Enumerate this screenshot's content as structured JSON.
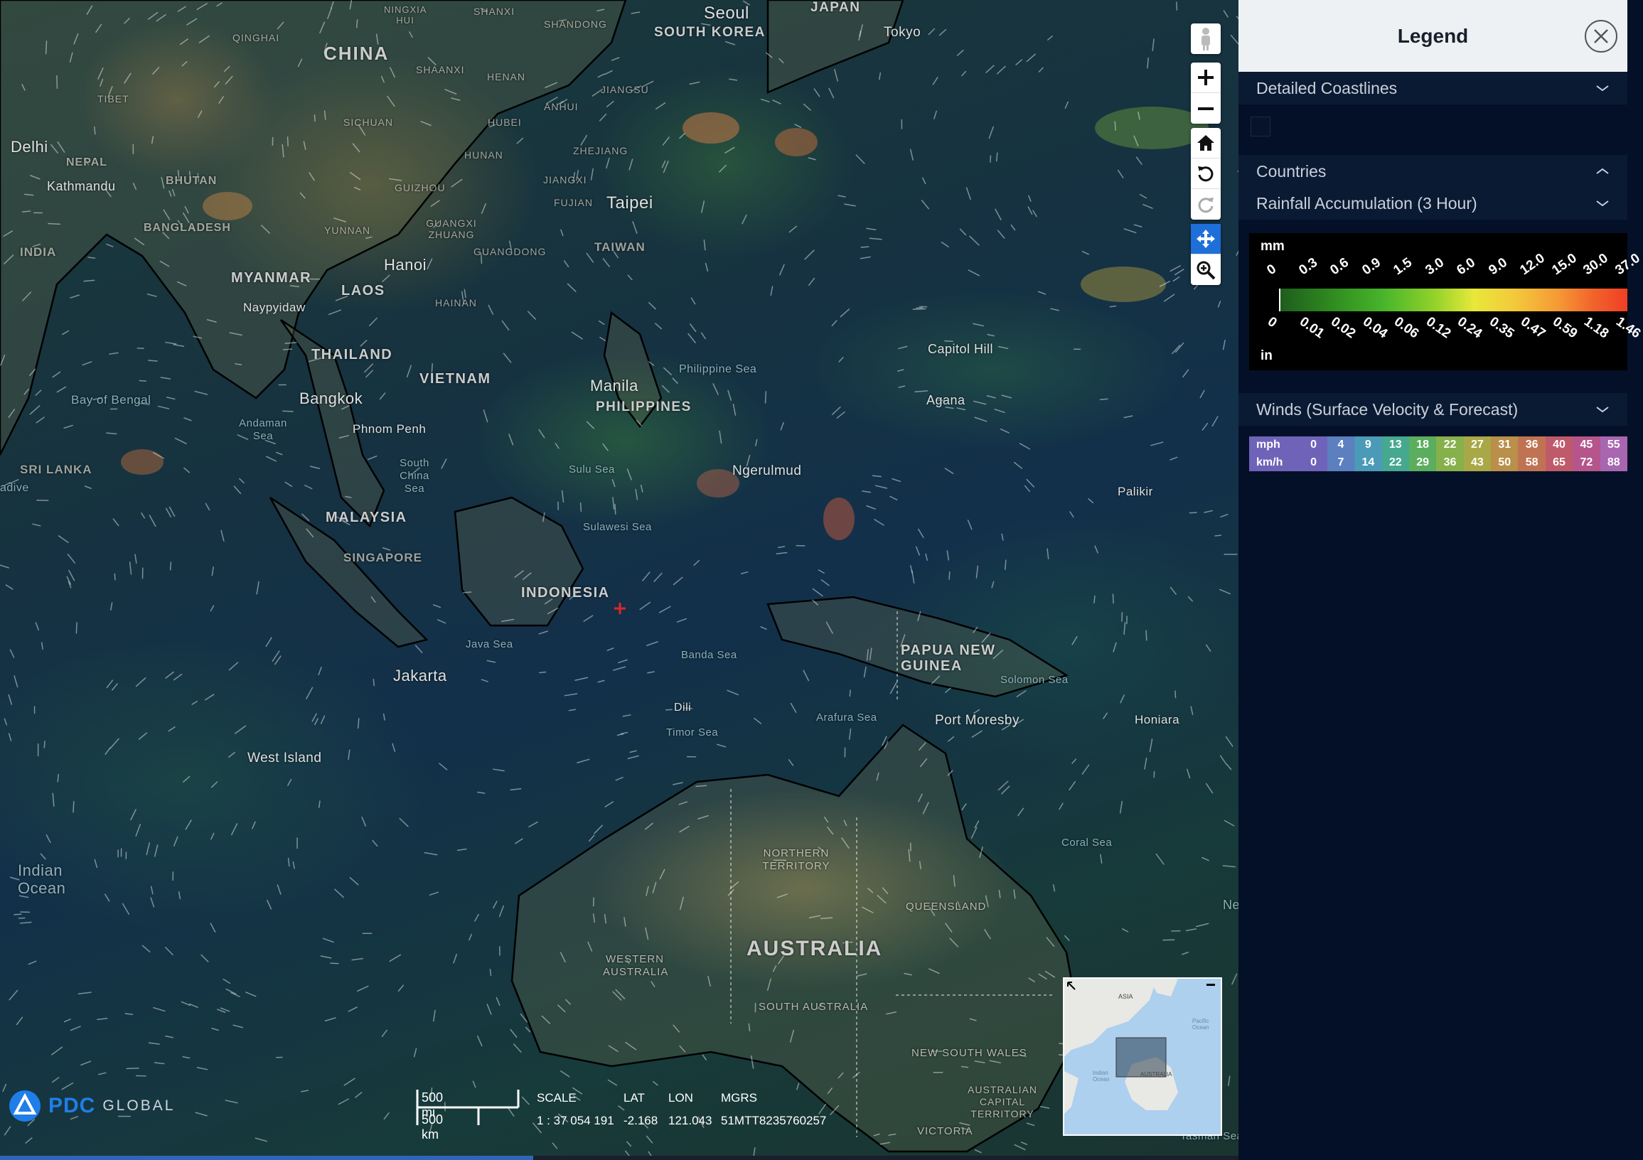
{
  "map": {
    "labels": {
      "countries": [
        "CHINA",
        "MYANMAR",
        "LAOS",
        "THAILAND",
        "VIETNAM",
        "MALAYSIA",
        "INDONESIA",
        "PAPUA NEW GUINEA",
        "AUSTRALIA",
        "INDIA",
        "BANGLADESH",
        "BHUTAN",
        "NEPAL",
        "SRI LANKA",
        "PHILIPPINES",
        "TAIWAN",
        "SINGAPORE",
        "SOUTH KOREA",
        "JAPAN"
      ],
      "regions": [
        "QINGHAI",
        "TIBET",
        "SICHUAN",
        "YUNNAN",
        "GUIZHOU",
        "HUNAN",
        "HUBEI",
        "HENAN",
        "SHAANXI",
        "ANHUI",
        "JIANGSU",
        "ZHEJIANG",
        "JIANGXI",
        "FUJIAN",
        "GUANGXI ZHUANG",
        "GUANGDONG",
        "NINGXIA HUI",
        "SHANXI",
        "SHANDONG",
        "HAINAN"
      ],
      "cities": [
        "Delhi",
        "Kathmandu",
        "Hanoi",
        "Naypyidaw",
        "Bangkok",
        "Phnom Penh",
        "Manila",
        "Taipei",
        "Seoul",
        "Tokyo",
        "Jakarta",
        "Ngerulmud",
        "Capitol Hill",
        "Agana",
        "Palikir",
        "Port Moresby",
        "Honiara",
        "West Island"
      ],
      "seas": [
        "Bay of Bengal",
        "Andaman Sea",
        "South China Sea",
        "Philippine Sea",
        "Sulu Sea",
        "Sulawesi Sea",
        "Java Sea",
        "Banda Sea",
        "Timor Sea",
        "Arafura Sea",
        "Solomon Sea",
        "Coral Sea"
      ],
      "oceans": [
        "Indian Ocean"
      ],
      "states": [
        "NORTHERN TERRITORY",
        "WESTERN AUSTRALIA",
        "QUEENSLAND",
        "SOUTH AUSTRALIA",
        "NEW SOUTH WALES",
        "AUSTRALIAN CAPITAL TERRITORY",
        "VICTORIA"
      ],
      "partial": [
        "Dili",
        "Tasman Sea",
        "adive",
        "Ne"
      ]
    },
    "toolbar": [
      {
        "name": "street-view-icon",
        "active": false
      },
      {
        "name": "zoom-in-icon",
        "active": false
      },
      {
        "name": "zoom-out-icon",
        "active": false
      },
      {
        "name": "home-icon",
        "active": false
      },
      {
        "name": "rotate-left-icon",
        "active": false
      },
      {
        "name": "rotate-right-icon",
        "active": false
      },
      {
        "name": "pan-icon",
        "active": true
      },
      {
        "name": "zoom-box-icon",
        "active": false
      }
    ],
    "scale": {
      "mi": "500 mi",
      "km": "500 km"
    },
    "readout": {
      "headers": [
        "SCALE",
        "LAT",
        "LON",
        "MGRS"
      ],
      "values": [
        "1 : 37 054 191",
        "-2.168",
        "121.043",
        "51MTT8235760257"
      ]
    },
    "logo": {
      "brand": "PDC",
      "suffix": "GLOBAL"
    },
    "overview": {
      "labels": [
        "ASIA",
        "Pacific Ocean",
        "Indian Ocean",
        "AUSTRALIA"
      ]
    }
  },
  "legend": {
    "title": "Legend",
    "sections": [
      {
        "label": "Detailed Coastlines",
        "expanded": true
      },
      {
        "label": "Countries",
        "expanded": false
      },
      {
        "label": "Rainfall Accumulation (3 Hour)",
        "expanded": true
      },
      {
        "label": "Winds (Surface Velocity & Forecast)",
        "expanded": true
      }
    ],
    "rainfall": {
      "unit_top": "mm",
      "unit_bottom": "in",
      "mm_ticks": [
        "0",
        "0.3",
        "0.6",
        "0.9",
        "1.5",
        "3.0",
        "6.0",
        "9.0",
        "12.0",
        "15.0",
        "30.0",
        "37.0"
      ],
      "in_ticks": [
        "0",
        "0.01",
        "0.02",
        "0.04",
        "0.06",
        "0.12",
        "0.24",
        "0.35",
        "0.47",
        "0.59",
        "1.18",
        "1.46"
      ]
    },
    "winds": {
      "mph_label": "mph",
      "kmh_label": "km/h",
      "mph": [
        "0",
        "4",
        "9",
        "13",
        "18",
        "22",
        "27",
        "31",
        "36",
        "40",
        "45",
        "55"
      ],
      "kmh": [
        "0",
        "7",
        "14",
        "22",
        "29",
        "36",
        "43",
        "50",
        "58",
        "65",
        "72",
        "88"
      ],
      "colors": [
        "#6e63b8",
        "#5b7fbf",
        "#4a9ab8",
        "#45a88f",
        "#5aae5e",
        "#86b04b",
        "#a9a847",
        "#b98f4a",
        "#c07352",
        "#bf5a6a",
        "#b5558c",
        "#a866b0"
      ]
    }
  }
}
